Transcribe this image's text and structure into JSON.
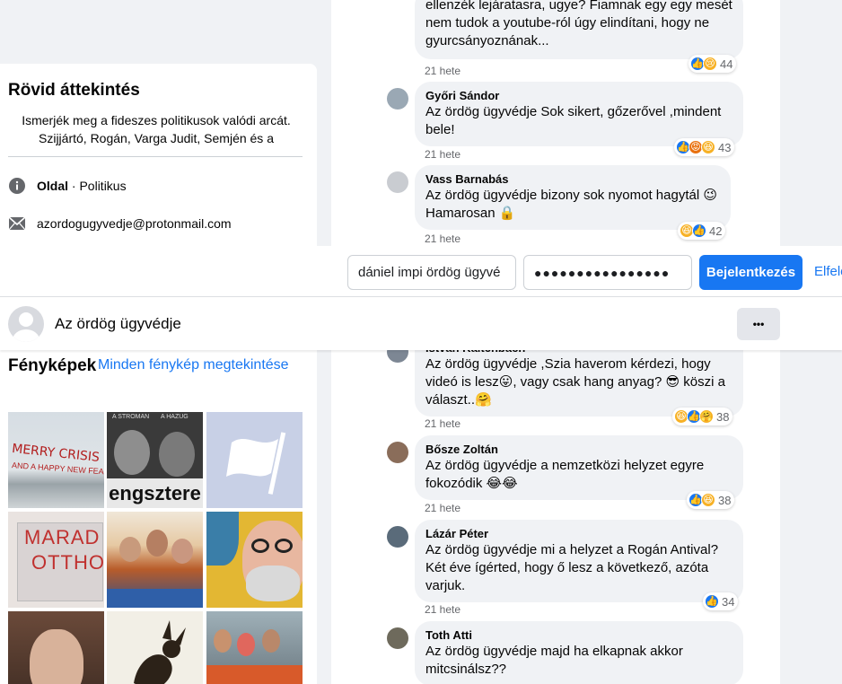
{
  "about": {
    "title": "Rövid áttekintés",
    "intro": "Ismerjék meg a fideszes politikusok valódi arcát. Szijjártó, Rogán, Varga Judit, Semjén és a",
    "category_bold": "Oldal",
    "category_rest": " · Politikus",
    "email": "azordogugyvedje@protonmail.com"
  },
  "comments": [
    {
      "author": "",
      "text": "ellenzék lejáratasra, ugye? Fiamnak egy egy mesét nem tudok a youtube-ról úgy elindítani, hogy ne gyurcsányoznának...",
      "time": "21 hete",
      "reactions": [
        "like",
        "sad"
      ],
      "count": "44"
    },
    {
      "author": "Győri Sándor",
      "text": "Az ördög ügyvédje Sok sikert, gőzerővel ,mindent bele!",
      "time": "21 hete",
      "reactions": [
        "like",
        "angry",
        "haha"
      ],
      "count": "43"
    },
    {
      "author": "Vass Barnabás",
      "text": "Az ördög ügyvédje bizony sok nyomot hagytál 😉 Hamarosan 🔒",
      "time": "21 hete",
      "reactions": [
        "haha",
        "like"
      ],
      "count": "42"
    },
    {
      "author": "István Kaltenbach",
      "text": "Az ördög ügyvédje ,Szia haverom kérdezi, hogy videó is lesz😛, vagy csak hang anyag? 😎 köszi a választ..🤗",
      "time": "21 hete",
      "reactions": [
        "haha",
        "like",
        "care"
      ],
      "count": "38"
    },
    {
      "author": "Bősze Zoltán",
      "text": "Az ördög ügyvédje a nemzetközi helyzet egyre fokozódik 😂😂",
      "time": "21 hete",
      "reactions": [
        "like",
        "haha"
      ],
      "count": "38"
    },
    {
      "author": "Lázár Péter",
      "text": "Az ördög ügyvédje mi a helyzet a Rogán Antival? Két éve ígérted, hogy ő lesz a következő, azóta varjuk.",
      "time": "21 hete",
      "reactions": [
        "like"
      ],
      "count": "34"
    },
    {
      "author": "Toth Atti",
      "text": "Az ördög ügyvédje majd ha elkapnak akkor mitcsinálsz??",
      "time": "",
      "reactions": [],
      "count": ""
    }
  ],
  "login": {
    "email_value": "dániel impi ördög ügyvé",
    "password_value": "●●●●●●●●●●●●●●●●",
    "login_button": "Bejelentkezés",
    "forgot_link": "Elfelejtett"
  },
  "page": {
    "name": "Az ördög ügyvédje",
    "more": "•••"
  },
  "photos": {
    "title": "Fényképek",
    "see_all": "Minden fénykép megtekintése",
    "tile1_text_line1": "MERRY CRISIS",
    "tile1_text_line2": "AND A HAPPY NEW FEAR",
    "tile2_label_left": "A STROMAN",
    "tile2_label_right": "A HAZUG",
    "tile2_banner": "engsztere",
    "tile4_text_line1": "MARAD",
    "tile4_text_line2": "OTTHO"
  },
  "colors": {
    "accent": "#1877f2",
    "bg": "#f0f2f5",
    "muted": "#65676b"
  }
}
